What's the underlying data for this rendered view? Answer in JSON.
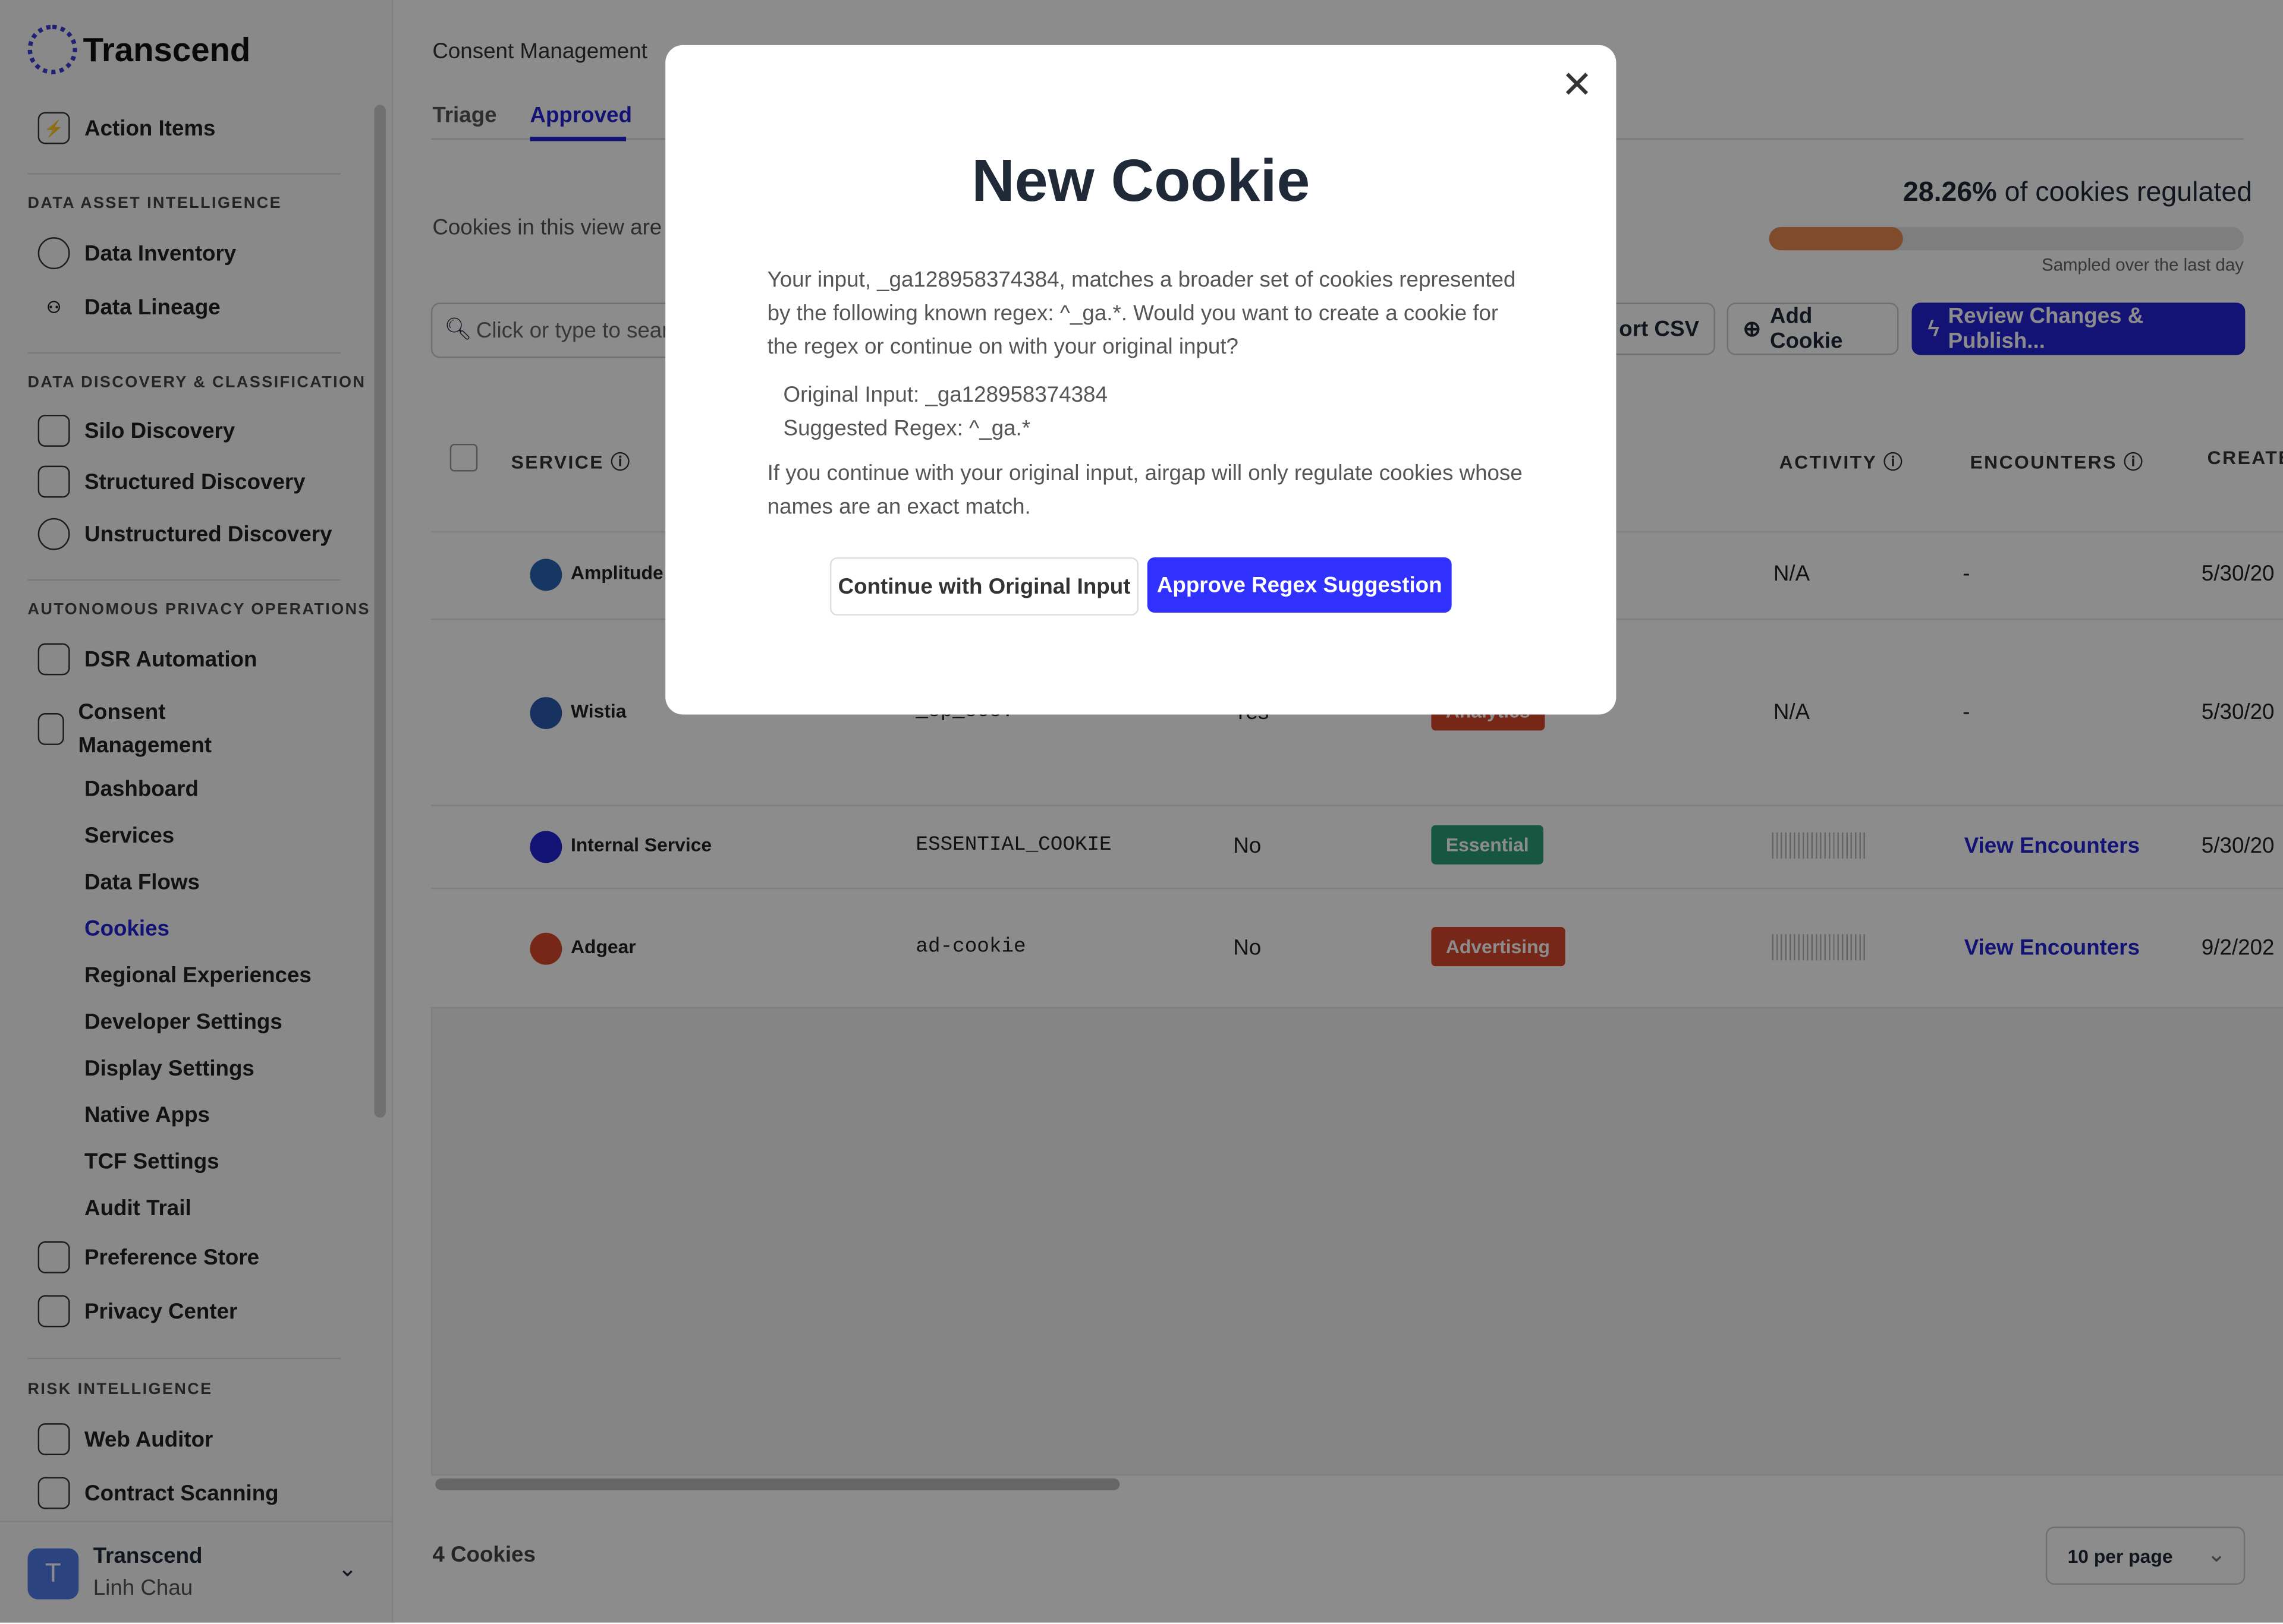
{
  "app": {
    "brand": "Transcend"
  },
  "sidebar": {
    "action_items": "Action Items",
    "sections": [
      "DATA ASSET INTELLIGENCE",
      "DATA DISCOVERY & CLASSIFICATION",
      "AUTONOMOUS PRIVACY OPERATIONS",
      "RISK INTELLIGENCE"
    ],
    "data_inventory": "Data Inventory",
    "data_lineage": "Data Lineage",
    "silo_discovery": "Silo Discovery",
    "structured_discovery": "Structured Discovery",
    "unstructured_discovery": "Unstructured Discovery",
    "dsr_automation": "DSR Automation",
    "consent_management": "Consent Management",
    "consent_sub": [
      "Dashboard",
      "Services",
      "Data Flows",
      "Cookies",
      "Regional Experiences",
      "Developer Settings",
      "Display Settings",
      "Native Apps",
      "TCF Settings",
      "Audit Trail"
    ],
    "active_sub": "Cookies",
    "preference_store": "Preference Store",
    "privacy_center": "Privacy Center",
    "web_auditor": "Web Auditor",
    "contract_scanning": "Contract Scanning",
    "user": {
      "org": "Transcend",
      "name": "Linh Chau",
      "initial": "T"
    }
  },
  "main": {
    "breadcrumb": "Consent Management",
    "tabs": [
      "Triage",
      "Approved"
    ],
    "active_tab": "Approved",
    "description": "Cookies in this view are ac",
    "search_placeholder": "Click or type to search",
    "regulated": {
      "percent": "28.26%",
      "label": " of cookies regulated",
      "value": 28.26,
      "sub": "Sampled over the last day"
    },
    "buttons": {
      "export": "ort CSV",
      "add": "Add Cookie",
      "review": "Review Changes & Publish..."
    },
    "columns": {
      "service": "SERVICE",
      "activity": "ACTIVITY",
      "encounters": "ENCOUNTERS",
      "created": "CREATE"
    },
    "rows": [
      {
        "service": "Amplitude",
        "cookie": "",
        "regulated": "",
        "purpose": "",
        "activity": "N/A",
        "encounters": "-",
        "created": "5/30/20"
      },
      {
        "service": "Wistia",
        "cookie": "_sp_ses.*",
        "regulated": "Yes",
        "purpose": "Analytics",
        "activity": "N/A",
        "encounters": "-",
        "created": "5/30/20"
      },
      {
        "service": "Internal Service",
        "cookie": "ESSENTIAL_COOKIE",
        "regulated": "No",
        "purpose": "Essential",
        "activity": "",
        "encounters": "View Encounters",
        "created": "5/30/20"
      },
      {
        "service": "Adgear",
        "cookie": "ad-cookie",
        "regulated": "No",
        "purpose": "Advertising",
        "activity": "",
        "encounters": "View Encounters",
        "created": "9/2/202"
      }
    ],
    "count": "4 Cookies",
    "per_page": "10 per page"
  },
  "modal": {
    "title": "New Cookie",
    "body1": "Your input, _ga128958374384, matches a broader set of cookies represented by the following known regex: ^_ga.*. Would you want to create a cookie for the regex or continue on with your original input?",
    "original": "Original Input: _ga128958374384",
    "suggested": "Suggested Regex: ^_ga.*",
    "body2": "If you continue with your original input, airgap will only regulate cookies whose names are an exact match.",
    "continue": "Continue with Original Input",
    "approve": "Approve Regex Suggestion"
  },
  "colors": {
    "accent": "#2323d6",
    "primary_button": "#3030ff",
    "essential": "#2a9d76",
    "advertising": "#d9472b",
    "analytics": "#d9472b",
    "progress": "#e8894f"
  }
}
